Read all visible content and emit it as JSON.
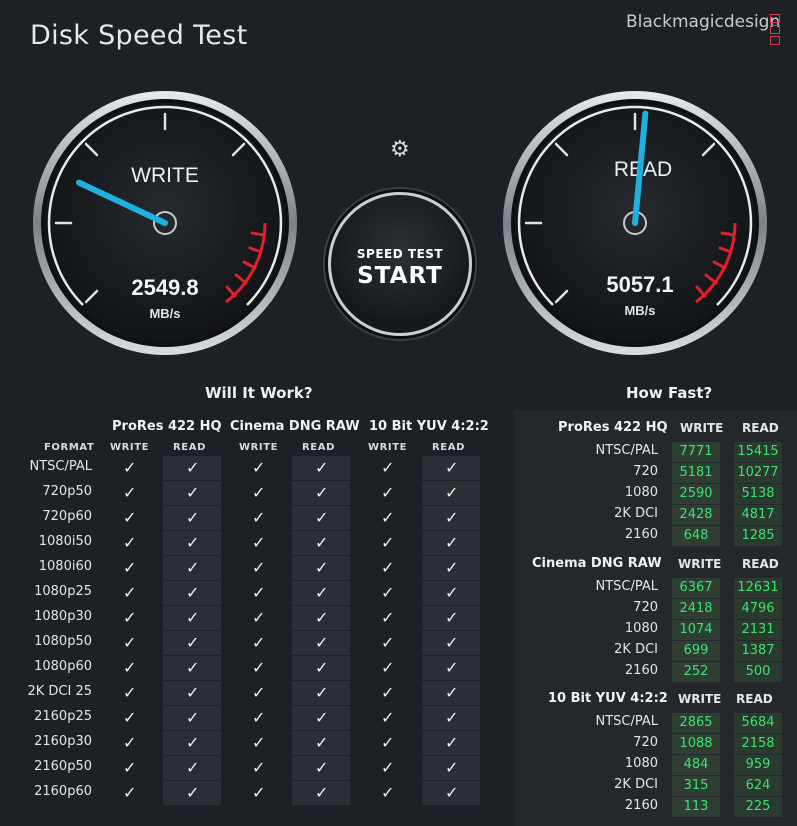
{
  "app": {
    "title": "Disk Speed Test",
    "brand": "Blackmagicdesign"
  },
  "gauges": {
    "write": {
      "label": "WRITE",
      "value": "2549.8",
      "unit": "MB/s",
      "needle_fraction": 0.26
    },
    "read": {
      "label": "READ",
      "value": "5057.1",
      "unit": "MB/s",
      "needle_fraction": 0.52
    }
  },
  "start_button": {
    "line1": "SPEED TEST",
    "line2": "START"
  },
  "settings_icon": "gear-icon",
  "will_it_work": {
    "title": "Will It Work?",
    "format_header": "FORMAT",
    "groups": [
      "ProRes 422 HQ",
      "Cinema DNG RAW",
      "10 Bit YUV 4:2:2"
    ],
    "write_header": "WRITE",
    "read_header": "READ",
    "check_glyph": "✓",
    "formats": [
      "NTSC/PAL",
      "720p50",
      "720p60",
      "1080i50",
      "1080i60",
      "1080p25",
      "1080p30",
      "1080p50",
      "1080p60",
      "2K DCI 25",
      "2160p25",
      "2160p30",
      "2160p50",
      "2160p60"
    ]
  },
  "how_fast": {
    "title": "How Fast?",
    "write_header": "WRITE",
    "read_header": "READ",
    "groups": [
      {
        "name": "ProRes 422 HQ",
        "rows": [
          {
            "format": "NTSC/PAL",
            "write": "7771",
            "read": "15415"
          },
          {
            "format": "720",
            "write": "5181",
            "read": "10277"
          },
          {
            "format": "1080",
            "write": "2590",
            "read": "5138"
          },
          {
            "format": "2K DCI",
            "write": "2428",
            "read": "4817"
          },
          {
            "format": "2160",
            "write": "648",
            "read": "1285"
          }
        ]
      },
      {
        "name": "Cinema DNG RAW",
        "rows": [
          {
            "format": "NTSC/PAL",
            "write": "6367",
            "read": "12631"
          },
          {
            "format": "720",
            "write": "2418",
            "read": "4796"
          },
          {
            "format": "1080",
            "write": "1074",
            "read": "2131"
          },
          {
            "format": "2K DCI",
            "write": "699",
            "read": "1387"
          },
          {
            "format": "2160",
            "write": "252",
            "read": "500"
          }
        ]
      },
      {
        "name": "10 Bit YUV 4:2:2",
        "rows": [
          {
            "format": "NTSC/PAL",
            "write": "2865",
            "read": "5684"
          },
          {
            "format": "720",
            "write": "1088",
            "read": "2158"
          },
          {
            "format": "1080",
            "write": "484",
            "read": "959"
          },
          {
            "format": "2K DCI",
            "write": "315",
            "read": "624"
          },
          {
            "format": "2160",
            "write": "113",
            "read": "225"
          }
        ]
      }
    ]
  },
  "colors": {
    "accent": "#1fb0e0",
    "redline": "#e0202a",
    "value_green": "#3fe070"
  }
}
